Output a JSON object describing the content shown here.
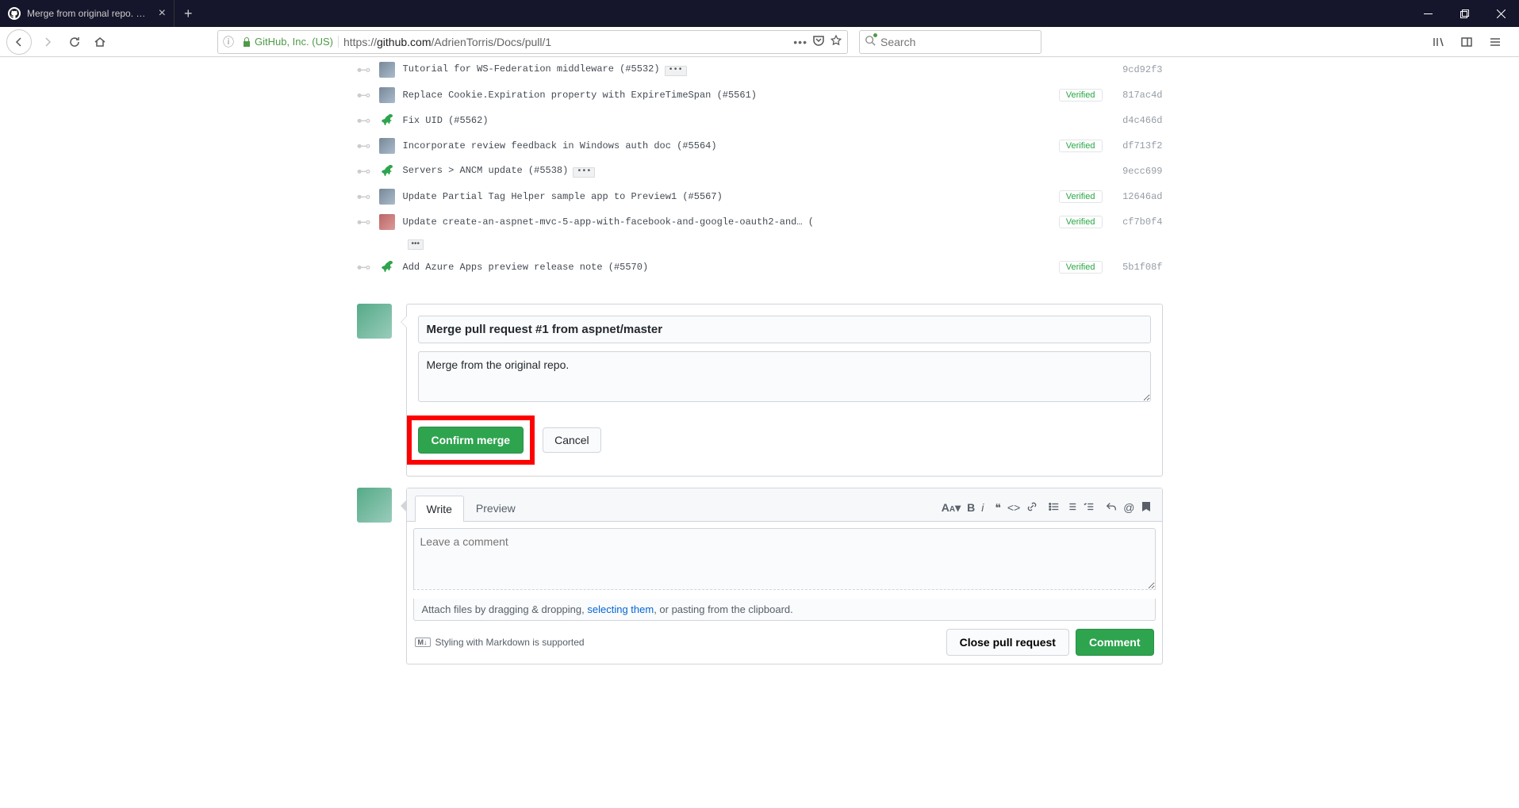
{
  "browser": {
    "tab_title": "Merge from original repo. by A",
    "url_identity": "GitHub, Inc. (US)",
    "url_prefix": "https://",
    "url_domain": "github.com",
    "url_path": "/AdrienTorris/Docs/pull/1",
    "search_placeholder": "Search"
  },
  "commits": [
    {
      "msg": "Tutorial for WS-Federation middleware (#5532)",
      "hash": "9cd92f3",
      "verified": false,
      "ellipsis": true,
      "avatar": "user"
    },
    {
      "msg": "Replace Cookie.Expiration property with ExpireTimeSpan (#5561)",
      "hash": "817ac4d",
      "verified": true,
      "ellipsis": false,
      "avatar": "user"
    },
    {
      "msg": "Fix UID (#5562)",
      "hash": "d4c466d",
      "verified": false,
      "ellipsis": false,
      "avatar": "trex"
    },
    {
      "msg": "Incorporate review feedback in Windows auth doc (#5564)",
      "hash": "df713f2",
      "verified": true,
      "ellipsis": false,
      "avatar": "user"
    },
    {
      "msg": "Servers > ANCM update (#5538)",
      "hash": "9ecc699",
      "verified": false,
      "ellipsis": true,
      "avatar": "trex"
    },
    {
      "msg": "Update Partial Tag Helper sample app to Preview1 (#5567)",
      "hash": "12646ad",
      "verified": true,
      "ellipsis": false,
      "avatar": "user"
    },
    {
      "msg": "Update create-an-aspnet-mvc-5-app-with-facebook-and-google-oauth2-and… (",
      "hash": "cf7b0f4",
      "verified": true,
      "ellipsis": true,
      "ellipsis_below": true,
      "avatar": "user2"
    },
    {
      "msg": "Add Azure Apps preview release note (#5570)",
      "hash": "5b1f08f",
      "verified": true,
      "ellipsis": false,
      "avatar": "trex"
    }
  ],
  "merge": {
    "title": "Merge pull request #1 from aspnet/master",
    "description": "Merge from the original repo.",
    "confirm_label": "Confirm merge",
    "cancel_label": "Cancel"
  },
  "comment": {
    "write_tab": "Write",
    "preview_tab": "Preview",
    "placeholder": "Leave a comment",
    "attach_prefix": "Attach files by dragging & dropping, ",
    "attach_link": "selecting them",
    "attach_suffix": ", or pasting from the clipboard.",
    "md_hint": "Styling with Markdown is supported",
    "close_pr_label": "Close pull request",
    "comment_label": "Comment"
  },
  "labels": {
    "verified": "Verified"
  }
}
